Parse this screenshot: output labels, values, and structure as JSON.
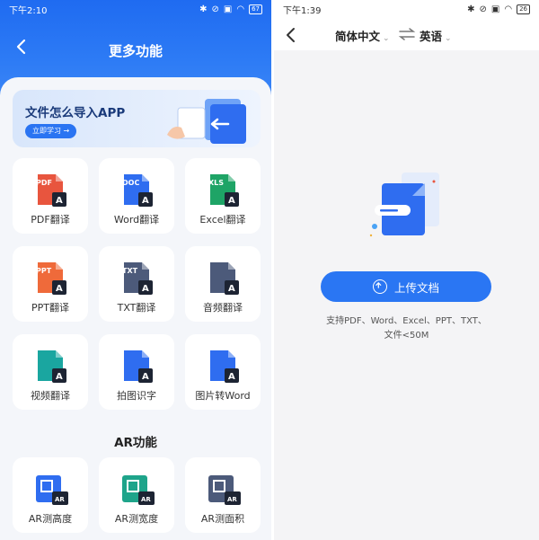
{
  "left": {
    "status": {
      "time": "下午2:10",
      "battery": "67"
    },
    "title": "更多功能",
    "banner": {
      "text": "文件怎么导入APP",
      "button": "立即学习 →"
    },
    "tiles": [
      {
        "badge": "PDF",
        "label": "PDF翻译",
        "color": "#e8553e"
      },
      {
        "badge": "DOC",
        "label": "Word翻译",
        "color": "#2f6df0"
      },
      {
        "badge": "XLS",
        "label": "Excel翻译",
        "color": "#1ea466"
      },
      {
        "badge": "PPT",
        "label": "PPT翻译",
        "color": "#ef6a3a"
      },
      {
        "badge": "TXT",
        "label": "TXT翻译",
        "color": "#4c5a7a"
      },
      {
        "badge": "",
        "label": "音频翻译",
        "color": "#4c5a7a"
      },
      {
        "badge": "",
        "label": "视频翻译",
        "color": "#1aa6a0"
      },
      {
        "badge": "",
        "label": "拍图识字",
        "color": "#2f6df0"
      },
      {
        "badge": "",
        "label": "图片转Word",
        "color": "#2f6df0"
      }
    ],
    "ar_title": "AR功能",
    "ar_tiles": [
      {
        "label": "AR测高度",
        "color": "#2f6df0"
      },
      {
        "label": "AR测宽度",
        "color": "#1ea48a"
      },
      {
        "label": "AR测面积",
        "color": "#4c5a7a"
      }
    ],
    "ar_badge": "AR"
  },
  "right": {
    "status": {
      "time": "下午1:39",
      "battery": "26"
    },
    "source_lang": "简体中文",
    "target_lang": "英语",
    "upload_label": "上传文档",
    "hint_line1": "支持PDF、Word、Excel、PPT、TXT、",
    "hint_line2": "文件<50M"
  }
}
